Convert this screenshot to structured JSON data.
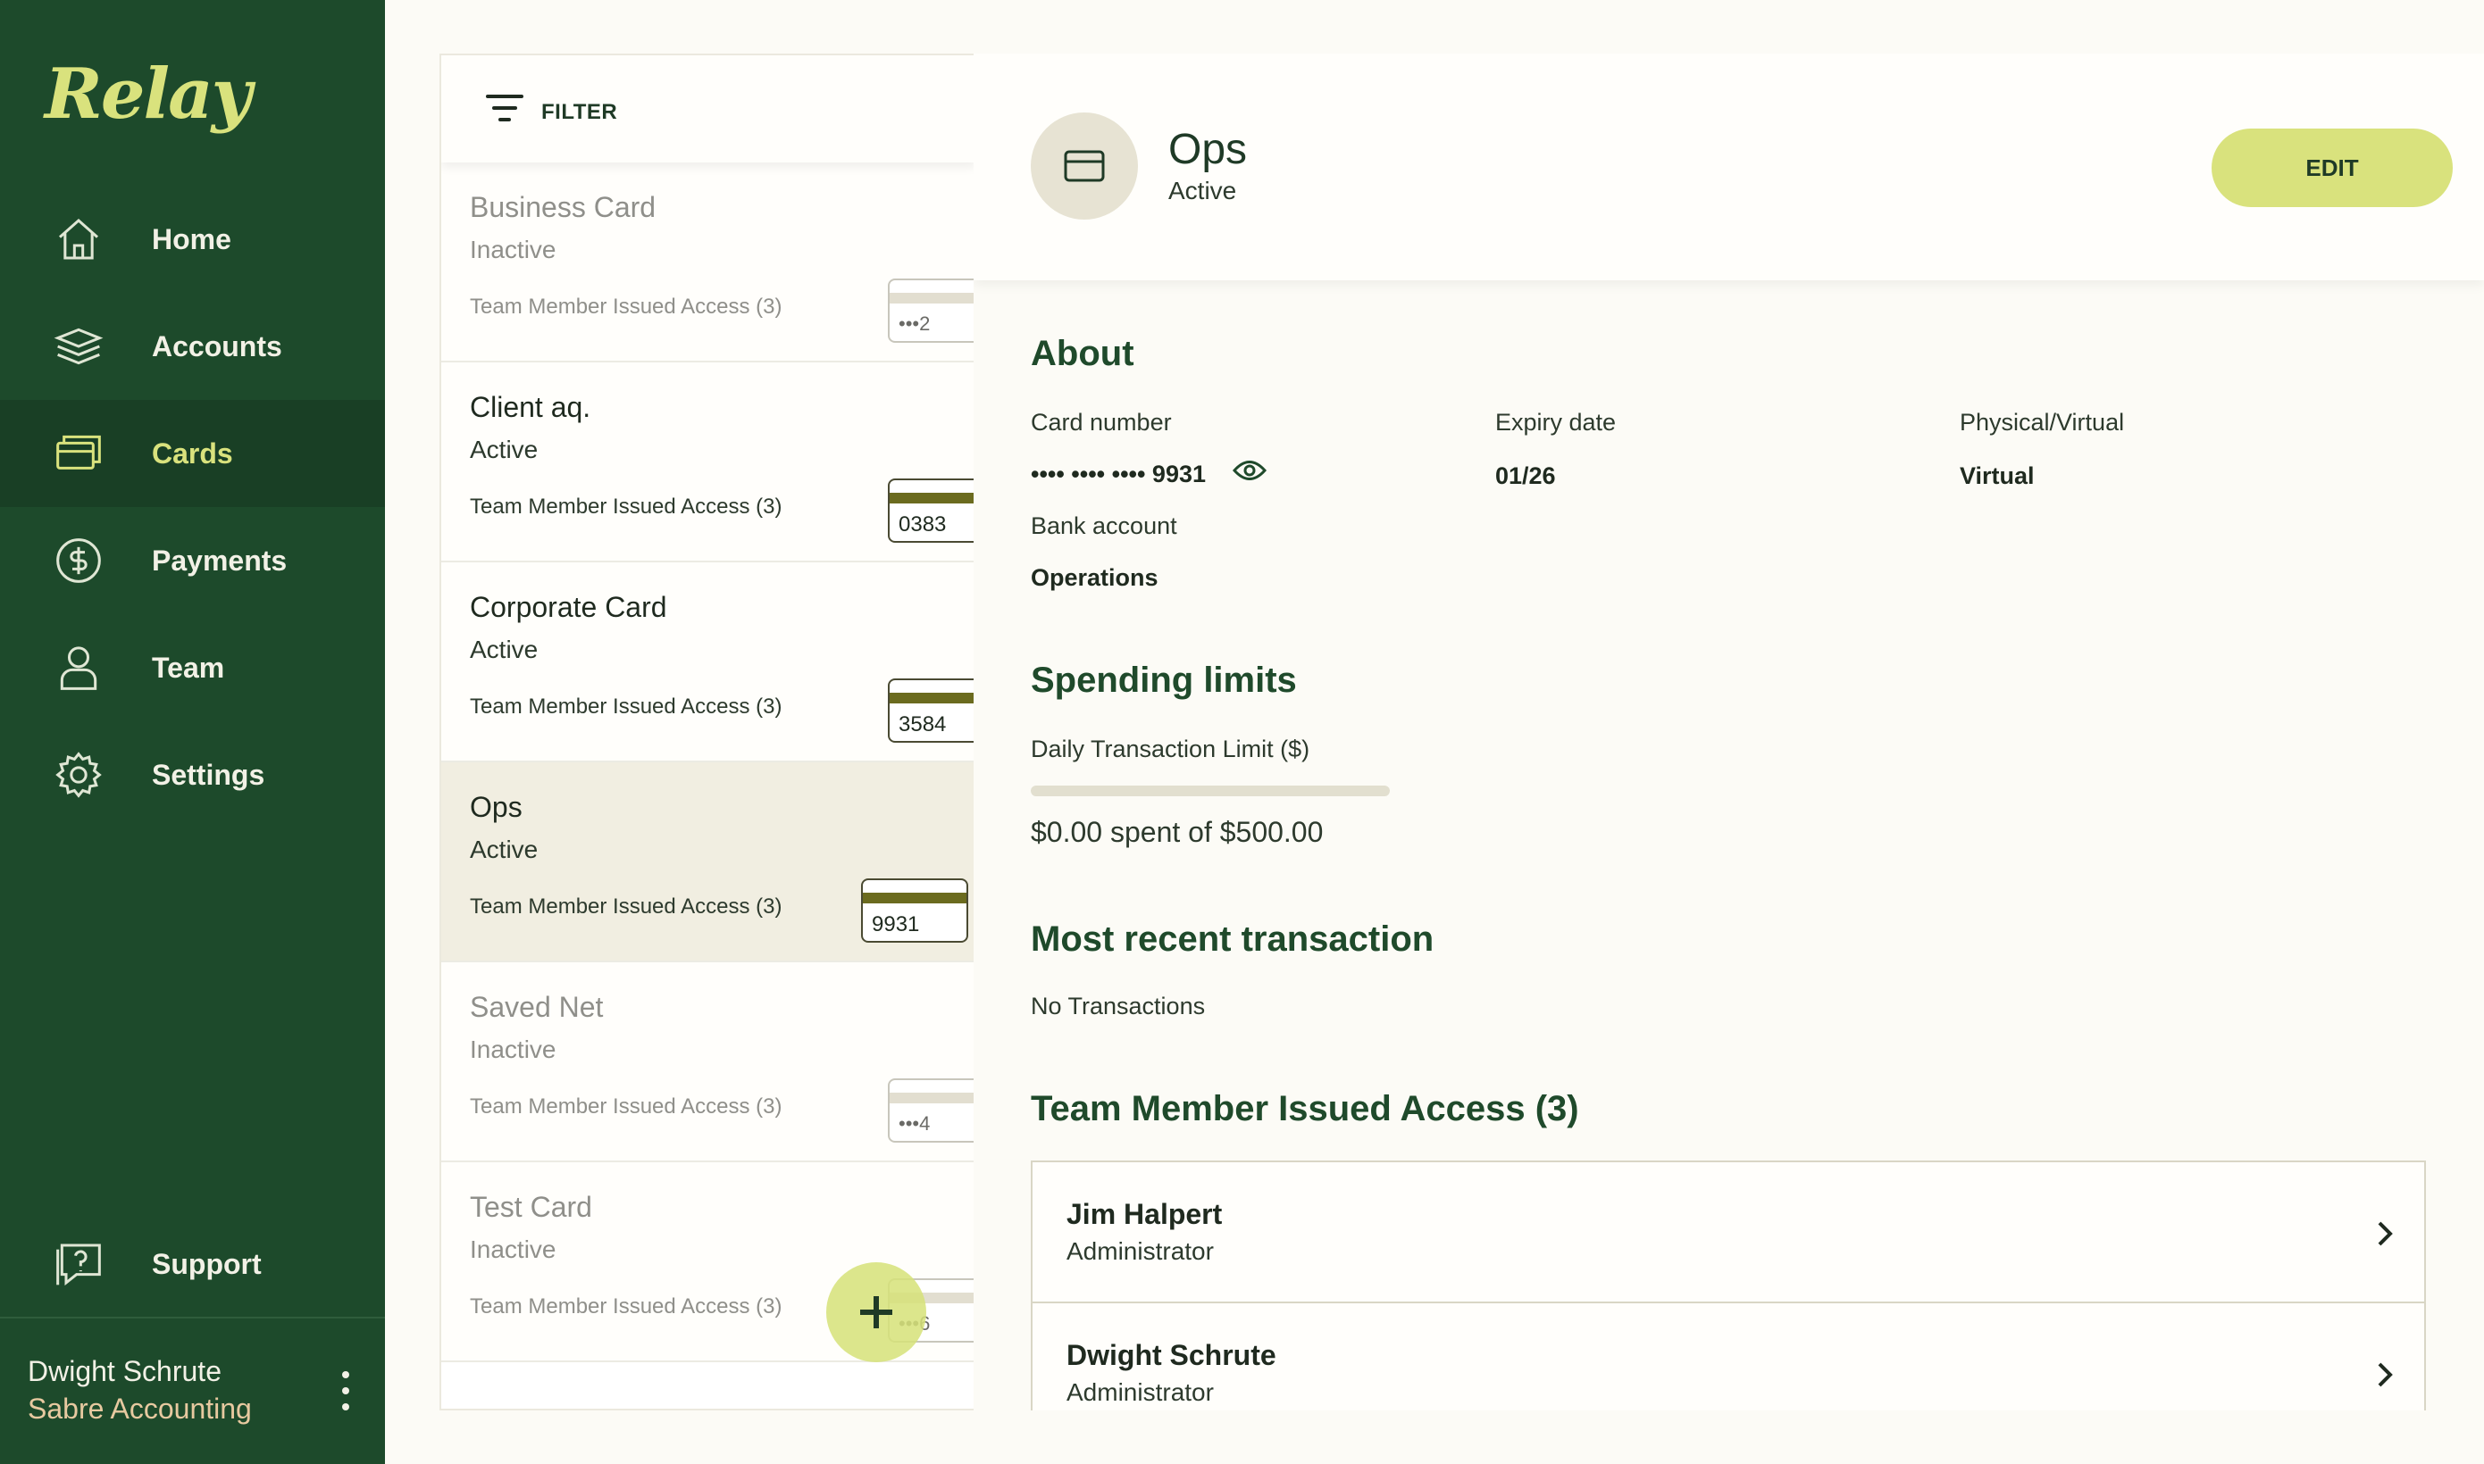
{
  "app": {
    "logo": "Relay"
  },
  "nav": {
    "items": [
      {
        "label": "Home",
        "icon": "home-icon"
      },
      {
        "label": "Accounts",
        "icon": "layers-icon"
      },
      {
        "label": "Cards",
        "icon": "cards-icon",
        "active": true
      },
      {
        "label": "Payments",
        "icon": "dollar-icon"
      },
      {
        "label": "Team",
        "icon": "person-icon"
      },
      {
        "label": "Settings",
        "icon": "gear-icon"
      }
    ],
    "support": {
      "label": "Support",
      "icon": "support-icon"
    }
  },
  "user": {
    "name": "Dwight Schrute",
    "org": "Sabre Accounting"
  },
  "filter": {
    "label": "FILTER"
  },
  "cards": [
    {
      "name": "Business Card",
      "status": "Inactive",
      "access": "Team Member Issued Access (3)",
      "digits": "•••2",
      "active": false
    },
    {
      "name": "Client aq.",
      "status": "Active",
      "access": "Team Member Issued Access (3)",
      "digits": "0383",
      "active": true
    },
    {
      "name": "Corporate Card",
      "status": "Active",
      "access": "Team Member Issued Access (3)",
      "digits": "3584",
      "active": true
    },
    {
      "name": "Ops",
      "status": "Active",
      "access": "Team Member Issued Access (3)",
      "digits": "9931",
      "active": true,
      "selected": true
    },
    {
      "name": "Saved Net",
      "status": "Inactive",
      "access": "Team Member Issued Access (3)",
      "digits": "•••4",
      "active": false
    },
    {
      "name": "Test Card",
      "status": "Inactive",
      "access": "Team Member Issued Access (3)",
      "digits": "•••6",
      "active": false
    }
  ],
  "detail": {
    "title": "Ops",
    "status": "Active",
    "edit_label": "EDIT",
    "about": {
      "heading": "About",
      "card_number_label": "Card number",
      "card_number": "•••• •••• •••• 9931",
      "expiry_label": "Expiry date",
      "expiry": "01/26",
      "type_label": "Physical/Virtual",
      "type": "Virtual",
      "bank_label": "Bank account",
      "bank": "Operations"
    },
    "limits": {
      "heading": "Spending limits",
      "daily_label": "Daily Transaction Limit ($)",
      "spent_fraction": 0,
      "spent_text": "$0.00 spent of $500.00"
    },
    "recent": {
      "heading": "Most recent transaction",
      "empty": "No Transactions"
    },
    "members": {
      "heading": "Team Member Issued Access (3)",
      "list": [
        {
          "name": "Jim Halpert",
          "role": "Administrator"
        },
        {
          "name": "Dwight Schrute",
          "role": "Administrator"
        }
      ]
    }
  },
  "colors": {
    "sidebar": "#1d4a2b",
    "accent": "#d9e27d",
    "background": "#fcfbf6"
  }
}
